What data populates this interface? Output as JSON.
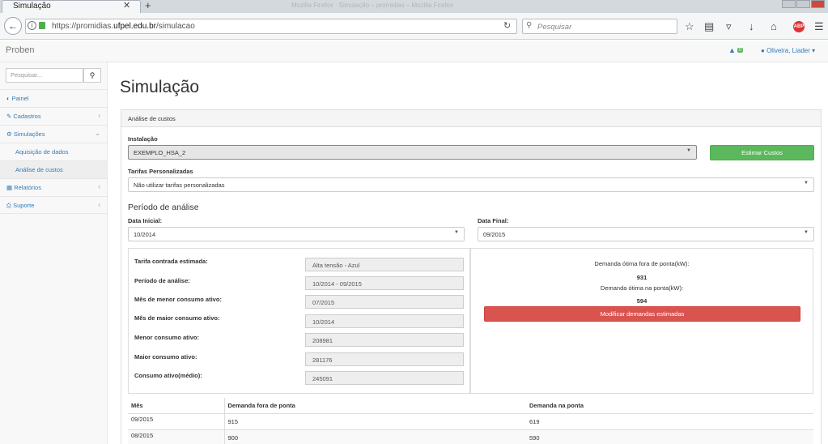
{
  "browser": {
    "tab_title": "Simulação",
    "tab_close": "✕",
    "new_tab": "+",
    "background_title": "Mozilla Firefox  ·  Simulação – promidias – Mozilla Firefox",
    "url_prefix": "https://promidias.",
    "url_domain": "ufpel.edu.br",
    "url_path": "/simulacao",
    "search_placeholder": "Pesquisar",
    "abp_label": "ABP"
  },
  "header": {
    "brand": "Proben",
    "notification_count": "0",
    "user_name": "Oliveira, Liader"
  },
  "sidebar": {
    "search_placeholder": "Pesquisar...",
    "items": [
      {
        "label": "Painel",
        "icon": "dashboard-icon"
      },
      {
        "label": "Cadastros",
        "icon": "edit-icon"
      },
      {
        "label": "Simulações",
        "icon": "gear-icon"
      },
      {
        "label": "Aquisição de dados"
      },
      {
        "label": "Análise de custos"
      },
      {
        "label": "Relatórios",
        "icon": "table-icon"
      },
      {
        "label": "Suporte",
        "icon": "print-icon"
      }
    ]
  },
  "main": {
    "title": "Simulação",
    "panel_title": "Análise de custos",
    "instalacao_label": "Instalação",
    "instalacao_value": "EXEMPLO_HSA_2",
    "estimar_button": "Estimar Custos",
    "tarifas_label": "Tarifas Personalizadas",
    "tarifas_value": "Não utilizar tarifas personalizadas",
    "periodo_heading": "Período de análise",
    "data_inicial_label": "Data Inicial:",
    "data_inicial_value": "10/2014",
    "data_final_label": "Data Final:",
    "data_final_value": "09/2015"
  },
  "summary": [
    {
      "label": "Tarifa contrada estimada:",
      "value": "Alta tensão - Azul"
    },
    {
      "label": "Período de análise:",
      "value": "10/2014 - 09/2015"
    },
    {
      "label": "Mês de menor consumo ativo:",
      "value": "07/2015"
    },
    {
      "label": "Mês de maior consumo ativo:",
      "value": "10/2014"
    },
    {
      "label": "Menor consumo ativo:",
      "value": "208981"
    },
    {
      "label": "Maior consumo ativo:",
      "value": "281176"
    },
    {
      "label": "Consumo ativo(médio):",
      "value": "245091"
    }
  ],
  "demand": {
    "fora_label": "Demanda ótima fora de ponta(kW):",
    "fora_value": "931",
    "na_label": "Demanda ótima na ponta(kW):",
    "na_value": "594",
    "modify_button": "Modificar demandas estimadas"
  },
  "table": {
    "headers": [
      "Mês",
      "Demanda fora de ponta",
      "Demanda na ponta"
    ],
    "rows": [
      [
        "09/2015",
        "915",
        "619"
      ],
      [
        "08/2015",
        "900",
        "590"
      ]
    ]
  }
}
